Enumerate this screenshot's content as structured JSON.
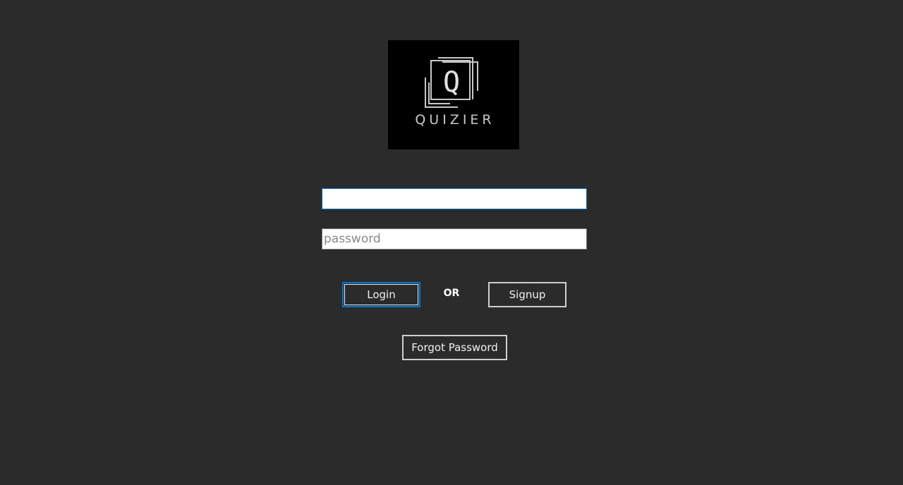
{
  "logo": {
    "text": "QUIZIER",
    "glyph": "Q"
  },
  "form": {
    "username": {
      "value": "",
      "placeholder": ""
    },
    "password": {
      "value": "",
      "placeholder": "password"
    }
  },
  "actions": {
    "login_label": "Login",
    "or_label": "OR",
    "signup_label": "Signup",
    "forgot_label": "Forgot Password"
  },
  "colors": {
    "background": "#2b2b2b",
    "focus_accent": "#0078d7",
    "logo_background": "#000000"
  }
}
